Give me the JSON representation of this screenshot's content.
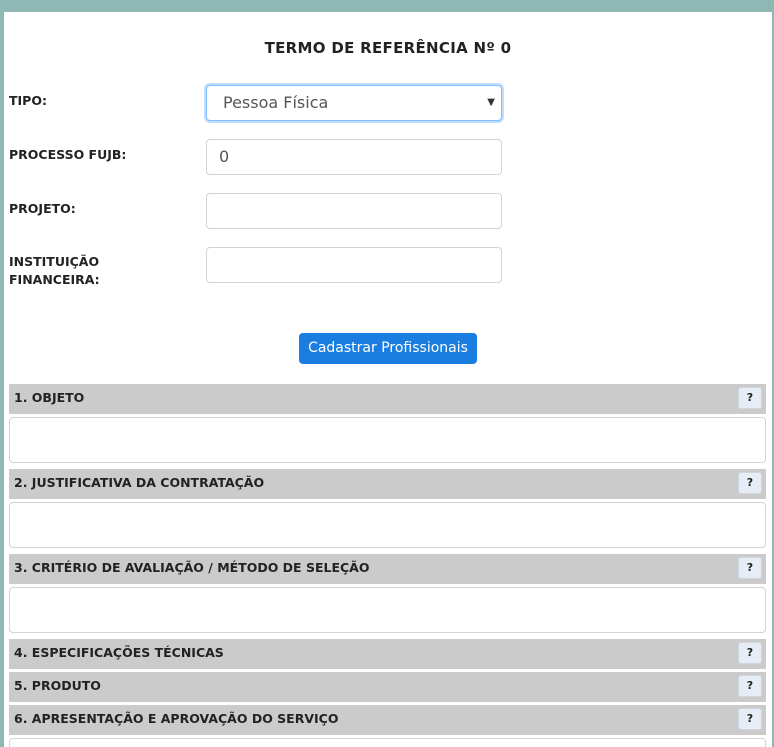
{
  "form": {
    "title": "TERMO DE REFERÊNCIA Nº 0",
    "tipo_label": "TIPO:",
    "tipo_value": "Pessoa Física",
    "processo_label": "PROCESSO FUJB:",
    "processo_value": "0",
    "projeto_label": "PROJETO:",
    "projeto_value": "",
    "instituicao_label_line1": "INSTITUIÇÃO",
    "instituicao_label_line2": "FINANCEIRA:",
    "instituicao_value": "",
    "cadastrar_button": "Cadastrar Profissionais"
  },
  "sections": [
    {
      "title": "1. OBJETO",
      "help": "?"
    },
    {
      "title": "2. JUSTIFICATIVA DA CONTRATAÇÃO",
      "help": "?"
    },
    {
      "title": "3. CRITÉRIO DE AVALIAÇÃO / MÉTODO DE SELEÇÃO",
      "help": "?"
    },
    {
      "title": "4. ESPECIFICAÇÕES TÉCNICAS",
      "help": "?"
    },
    {
      "title": "5. PRODUTO",
      "help": "?"
    },
    {
      "title": "6. APRESENTAÇÃO E APROVAÇÃO DO SERVIÇO",
      "help": "?"
    }
  ],
  "colors": {
    "background": "#8fb7b3",
    "primary_button": "#1a7ee0",
    "section_header": "#cbcbcb"
  }
}
